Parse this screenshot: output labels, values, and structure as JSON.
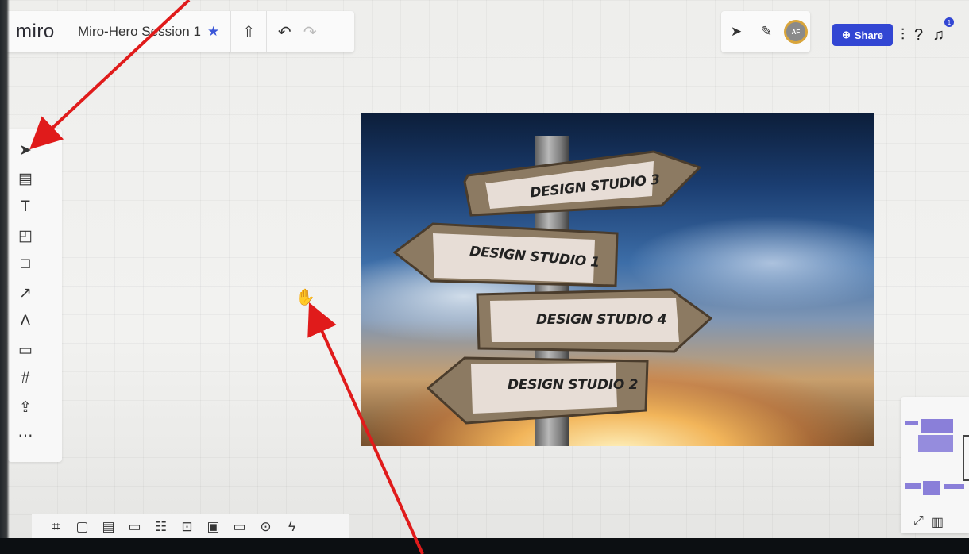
{
  "app": {
    "logo": "miro",
    "board_title": "Miro-Hero Session 1",
    "share_label": "Share",
    "avatar_initials": "AF",
    "notification_count": "1"
  },
  "left_toolbar": [
    {
      "name": "select-tool",
      "glyph": "➤"
    },
    {
      "name": "templates-tool",
      "glyph": "▤"
    },
    {
      "name": "text-tool",
      "glyph": "T"
    },
    {
      "name": "sticky-note-tool",
      "glyph": "◰"
    },
    {
      "name": "shape-tool",
      "glyph": "□"
    },
    {
      "name": "connection-line-tool",
      "glyph": "↗"
    },
    {
      "name": "pen-tool",
      "glyph": "Λ"
    },
    {
      "name": "comment-tool",
      "glyph": "▭"
    },
    {
      "name": "frame-tool",
      "glyph": "#"
    },
    {
      "name": "upload-tool",
      "glyph": "⇪"
    },
    {
      "name": "more-tools",
      "glyph": "⋯"
    }
  ],
  "bottom_toolbar": [
    "⌗",
    "▢",
    "▤",
    "▭",
    "☷",
    "⊡",
    "▣",
    "▭",
    "⊙",
    "ϟ"
  ],
  "signs": {
    "sign1": "DESIGN STUDIO 3",
    "sign2": "DESIGN STUDIO 1",
    "sign3": "DESIGN STUDIO 4",
    "sign4": "DESIGN STUDIO 2"
  },
  "colors": {
    "accent": "#3246d3",
    "annotation_arrow": "#e01b1b"
  }
}
